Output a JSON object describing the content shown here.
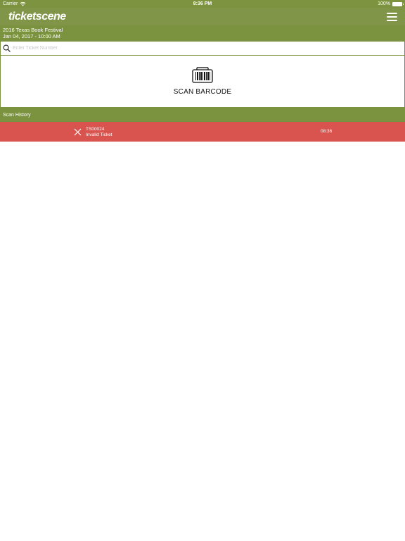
{
  "status_bar": {
    "carrier": "Carrier",
    "time": "8:36 PM",
    "battery": "100%"
  },
  "nav": {
    "logo": "ticketscene"
  },
  "event": {
    "name": "2016 Texas Book Festival",
    "date": "Jan 04, 2017 - 10:00 AM"
  },
  "search": {
    "placeholder": "Enter Ticket Number",
    "value": ""
  },
  "scan": {
    "label": "SCAN BARCODE"
  },
  "history": {
    "header": "Scan History",
    "items": [
      {
        "ticket": "TS00024",
        "status": "Invalid Ticket",
        "time": "08:36",
        "color": "#d9534f"
      }
    ]
  },
  "colors": {
    "brand_green": "#7b923e",
    "invalid_red": "#d9534f"
  }
}
